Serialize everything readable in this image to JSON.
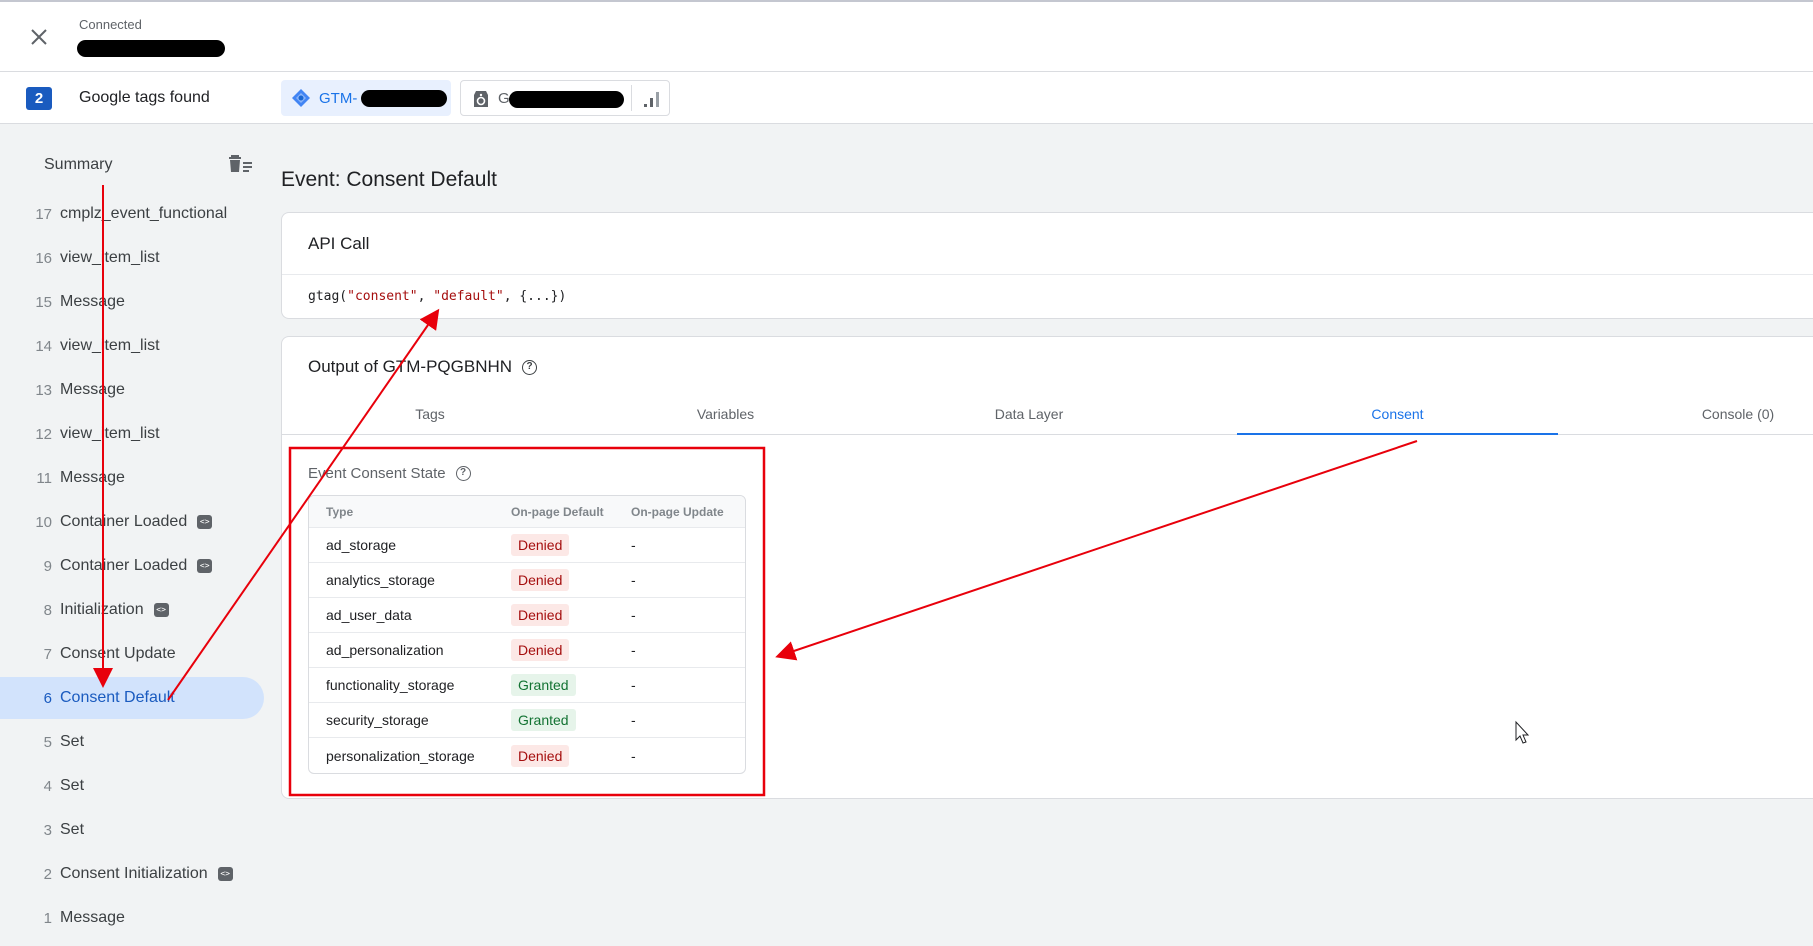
{
  "header": {
    "status": "Connected"
  },
  "tagsbar": {
    "count": "2",
    "label": "Google tags found",
    "gtm_chip_prefix": "GTM-",
    "ga_chip_prefix": "G"
  },
  "sidebar": {
    "summary": "Summary",
    "events": [
      {
        "num": "17",
        "name": "cmplz_event_functional",
        "code": false
      },
      {
        "num": "16",
        "name": "view_item_list",
        "code": false
      },
      {
        "num": "15",
        "name": "Message",
        "code": false
      },
      {
        "num": "14",
        "name": "view_item_list",
        "code": false
      },
      {
        "num": "13",
        "name": "Message",
        "code": false
      },
      {
        "num": "12",
        "name": "view_item_list",
        "code": false
      },
      {
        "num": "11",
        "name": "Message",
        "code": false
      },
      {
        "num": "10",
        "name": "Container Loaded",
        "code": true
      },
      {
        "num": "9",
        "name": "Container Loaded",
        "code": true
      },
      {
        "num": "8",
        "name": "Initialization",
        "code": true
      },
      {
        "num": "7",
        "name": "Consent Update",
        "code": false
      },
      {
        "num": "6",
        "name": "Consent Default",
        "code": false,
        "selected": true
      },
      {
        "num": "5",
        "name": "Set",
        "code": false
      },
      {
        "num": "4",
        "name": "Set",
        "code": false
      },
      {
        "num": "3",
        "name": "Set",
        "code": false
      },
      {
        "num": "2",
        "name": "Consent Initialization",
        "code": true
      },
      {
        "num": "1",
        "name": "Message",
        "code": false
      }
    ]
  },
  "main": {
    "event_title": "Event: Consent Default",
    "api_call": {
      "heading": "API Call",
      "code_prefix": "gtag(",
      "arg1": "\"consent\"",
      "sep": ", ",
      "arg2": "\"default\"",
      "code_suffix": ", {...})"
    },
    "output": {
      "heading": "Output of GTM-PQGBNHN",
      "tabs": [
        "Tags",
        "Variables",
        "Data Layer",
        "Consent",
        "Console (0)"
      ],
      "active_tab": "Consent",
      "consent_state_label": "Event Consent State",
      "table": {
        "headers": [
          "Type",
          "On-page Default",
          "On-page Update"
        ],
        "rows": [
          {
            "type": "ad_storage",
            "default": "Denied",
            "update": "-"
          },
          {
            "type": "analytics_storage",
            "default": "Denied",
            "update": "-"
          },
          {
            "type": "ad_user_data",
            "default": "Denied",
            "update": "-"
          },
          {
            "type": "ad_personalization",
            "default": "Denied",
            "update": "-"
          },
          {
            "type": "functionality_storage",
            "default": "Granted",
            "update": "-"
          },
          {
            "type": "security_storage",
            "default": "Granted",
            "update": "-"
          },
          {
            "type": "personalization_storage",
            "default": "Denied",
            "update": "-"
          }
        ]
      }
    }
  },
  "colors": {
    "accent": "#1a73e8",
    "annotation": "#e8000b",
    "denied_bg": "#fce8e6",
    "granted_bg": "#e6f4ea"
  }
}
